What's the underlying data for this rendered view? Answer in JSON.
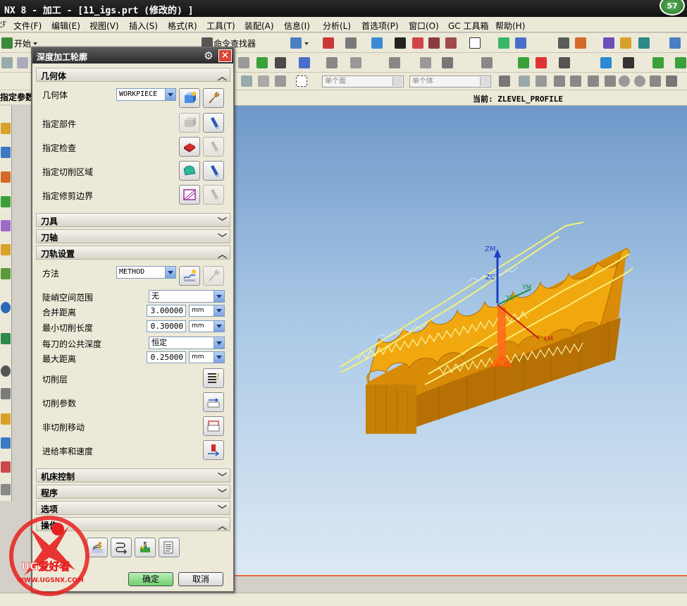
{
  "window": {
    "title": "NX 8 - 加工 - [11_igs.prt  (修改的) ]",
    "badge": "57"
  },
  "menu": [
    "文件(F)",
    "编辑(E)",
    "视图(V)",
    "插入(S)",
    "格式(R)",
    "工具(T)",
    "装配(A)",
    "信息(I)",
    "分析(L)",
    "首选项(P)",
    "窗口(O)",
    "GC 工具箱",
    "帮助(H)"
  ],
  "toolbar": {
    "start_label": "开始",
    "command_finder": "命令查找器",
    "filter1": "单个面",
    "filter2": "单个体"
  },
  "side_label": "指定参数",
  "infobar": {
    "current": "当前: ZLEVEL_PROFILE"
  },
  "dialog": {
    "title": "深度加工轮廓",
    "sections": {
      "geometry": "几何体",
      "tool": "刀具",
      "axis": "刀轴",
      "path": "刀轨设置",
      "machine": "机床控制",
      "program": "程序",
      "options": "选项",
      "actions": "操作"
    },
    "geometry": {
      "label": "几何体",
      "value": "WORKPIECE",
      "part": "指定部件",
      "check": "指定检查",
      "cut_area": "指定切削区域",
      "trim": "指定修剪边界"
    },
    "path": {
      "method_label": "方法",
      "method_value": "METHOD",
      "steep_label": "陡峭空间范围",
      "steep_value": "无",
      "merge_label": "合并距离",
      "merge_value": "3.00000",
      "merge_unit": "mm",
      "min_cut_label": "最小切削长度",
      "min_cut_value": "0.30000",
      "min_cut_unit": "mm",
      "depth_label": "每刀的公共深度",
      "depth_value": "恒定",
      "max_dist_label": "最大距离",
      "max_dist_value": "0.25000",
      "max_dist_unit": "mm",
      "cut_levels": "切削层",
      "cut_params": "切削参数",
      "non_cut": "非切削移动",
      "feeds": "进给率和速度"
    },
    "ok": "确定",
    "cancel": "取消"
  },
  "viewport": {
    "axis_zm": "ZM",
    "axis_zc": "ZC",
    "axis_yc": "YC",
    "axis_ym": "YM",
    "axis_xm": "XM"
  },
  "watermark": {
    "brand": "UG爱好者",
    "url": "WWW.UGSNX.COM"
  }
}
